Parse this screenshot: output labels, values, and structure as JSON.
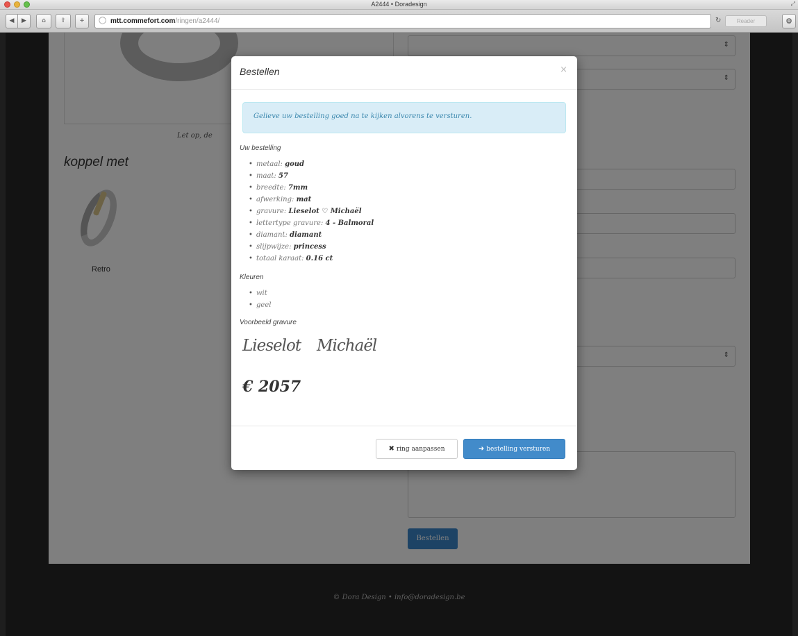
{
  "browser": {
    "window_title": "A2444 • Doradesign",
    "url_host": "mtt.commefort.com",
    "url_path": "/ringen/a2444/",
    "reader_label": "Reader"
  },
  "page": {
    "caption": "Let op, de",
    "couple_heading": "koppel met",
    "couple_ring_name": "Retro",
    "order_button": "Bestellen",
    "footer": "© Dora Design • info@doradesign.be"
  },
  "modal": {
    "title": "Bestellen",
    "close": "×",
    "alert": "Gelieve uw bestelling goed na te kijken alvorens te versturen.",
    "order_heading": "Uw bestelling",
    "order_items": [
      {
        "key": "metaal:",
        "value": "goud"
      },
      {
        "key": "maat:",
        "value": "57"
      },
      {
        "key": "breedte:",
        "value": "7mm"
      },
      {
        "key": "afwerking:",
        "value": "mat"
      },
      {
        "key": "gravure:",
        "value": "Lieselot ♡ Michaël"
      },
      {
        "key": "lettertype gravure:",
        "value": "4 - Balmoral"
      },
      {
        "key": "diamant:",
        "value": "diamant"
      },
      {
        "key": "slijpwijze:",
        "value": "princess"
      },
      {
        "key": "totaal karaat:",
        "value": "0.16 ct"
      }
    ],
    "colors_heading": "Kleuren",
    "colors": [
      "wit",
      "geel"
    ],
    "engraving_heading": "Voorbeeld gravure",
    "engraving_left": "Lieselot",
    "engraving_heart": "♡",
    "engraving_right": "Michaël",
    "price": "€ 2057",
    "adjust_button": "ring aanpassen",
    "send_button": "bestelling versturen"
  }
}
